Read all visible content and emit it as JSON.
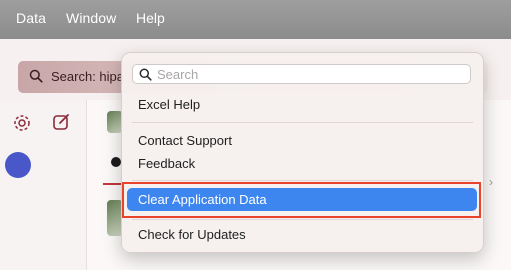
{
  "menubar": {
    "items": [
      "Data",
      "Window",
      "Help"
    ]
  },
  "app": {
    "search_label": "Search: hipa"
  },
  "help_menu": {
    "search_placeholder": "Search",
    "items": {
      "excel_help": "Excel Help",
      "contact_support": "Contact Support",
      "feedback": "Feedback",
      "clear_application_data": "Clear Application Data",
      "check_for_updates": "Check for Updates"
    }
  },
  "colors": {
    "menubar_bg": "#8c8c8c",
    "highlight": "#3d86f0",
    "annotation_outline": "#e8442c",
    "accent_purple": "#4957c8"
  }
}
